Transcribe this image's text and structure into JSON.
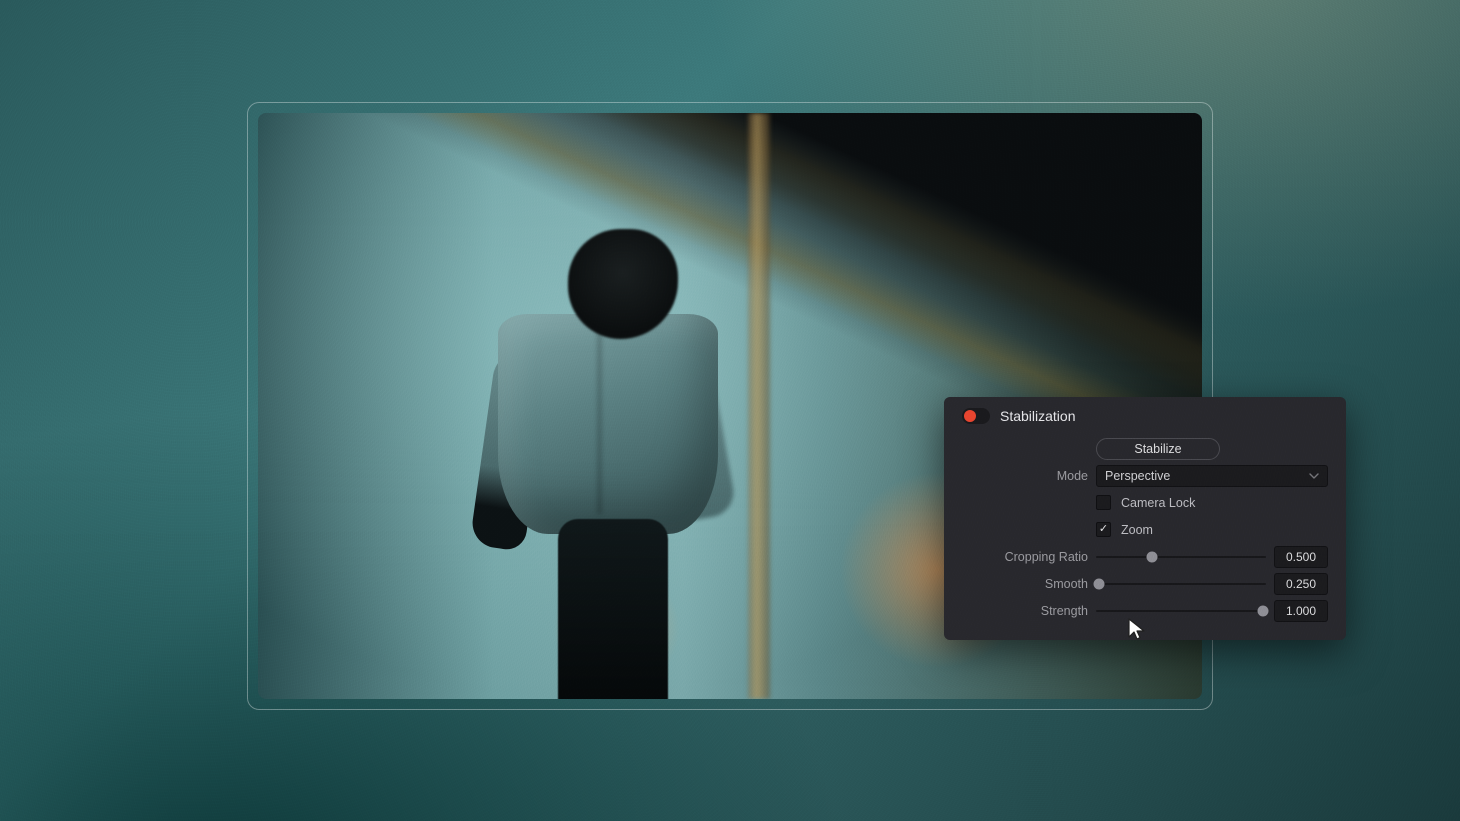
{
  "panel": {
    "title": "Stabilization",
    "enabled_color": "#e8452f",
    "stabilize_button": "Stabilize",
    "mode_label": "Mode",
    "mode_value": "Perspective",
    "camera_lock": {
      "label": "Camera Lock",
      "checked": false
    },
    "zoom": {
      "label": "Zoom",
      "checked": true
    },
    "cropping_ratio": {
      "label": "Cropping Ratio",
      "value": "0.500",
      "pos": 0.33
    },
    "smooth": {
      "label": "Smooth",
      "value": "0.250",
      "pos": 0.02
    },
    "strength": {
      "label": "Strength",
      "value": "1.000",
      "pos": 0.98
    }
  }
}
